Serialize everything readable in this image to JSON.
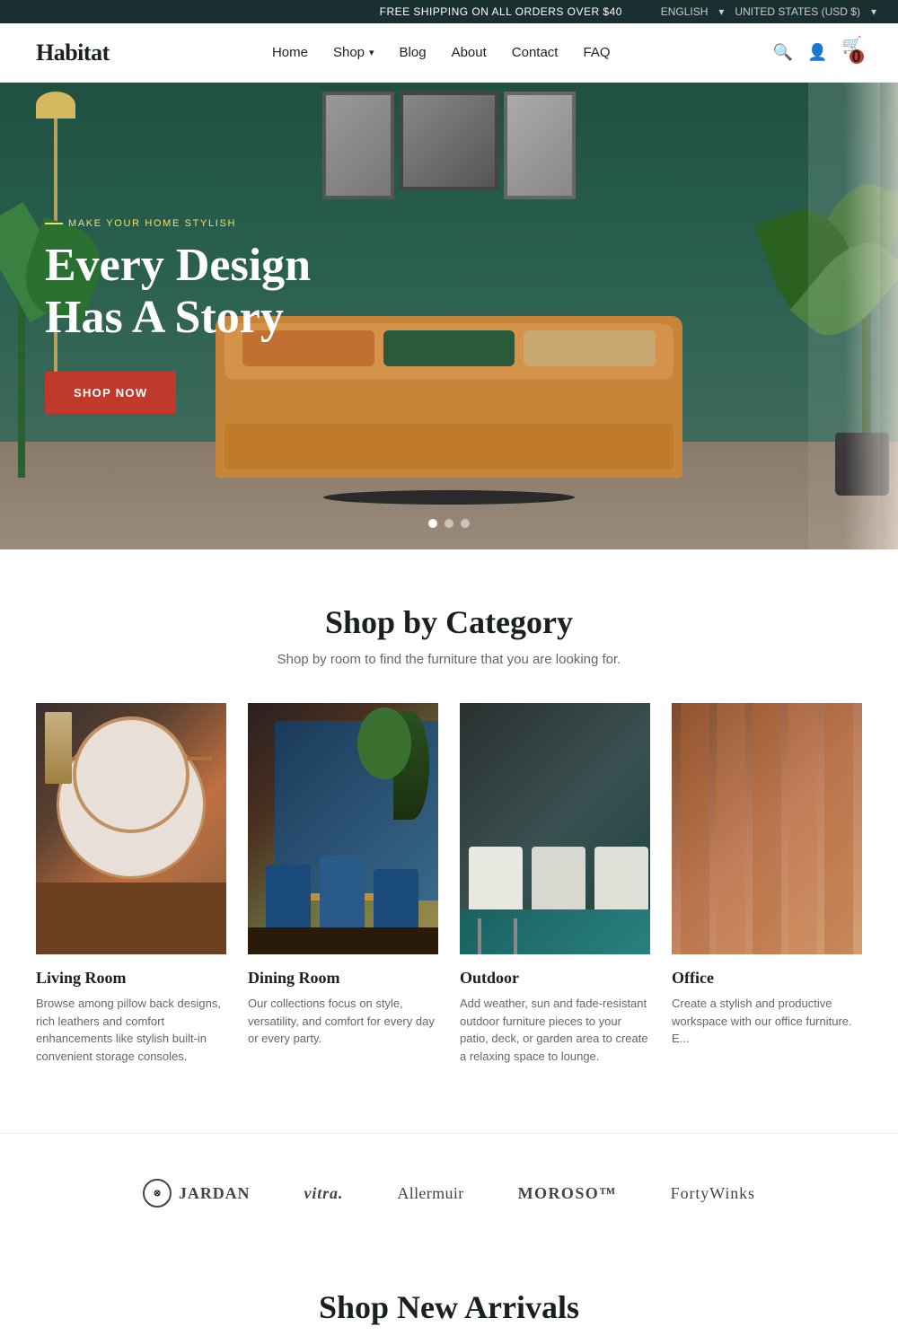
{
  "topbar": {
    "shipping_notice": "FREE SHIPPING ON ALL ORDERS OVER $40",
    "language": "ENGLISH",
    "currency": "UNITED STATES (USD $)"
  },
  "header": {
    "logo": "Habitat",
    "nav": [
      {
        "label": "Home",
        "id": "home"
      },
      {
        "label": "Shop",
        "id": "shop",
        "has_dropdown": true
      },
      {
        "label": "Blog",
        "id": "blog"
      },
      {
        "label": "About",
        "id": "about"
      },
      {
        "label": "Contact",
        "id": "contact"
      },
      {
        "label": "FAQ",
        "id": "faq"
      }
    ],
    "cart_count": "0"
  },
  "hero": {
    "subtitle": "MAKE YOUR HOME STYLISH",
    "title": "Every Design Has A Story",
    "cta_label": "SHOP NOW",
    "dots": [
      1,
      2,
      3
    ],
    "active_dot": 0
  },
  "shop_category": {
    "title": "Shop by Category",
    "subtitle": "Shop by room to find the furniture that you are looking for.",
    "categories": [
      {
        "name": "Living Room",
        "description": "Browse among pillow back designs, rich leathers and comfort enhancements like stylish built-in convenient storage consoles.",
        "id": "living-room"
      },
      {
        "name": "Dining Room",
        "description": "Our collections focus on style, versatility, and comfort for every day or every party.",
        "id": "dining-room"
      },
      {
        "name": "Outdoor",
        "description": "Add weather, sun and fade-resistant outdoor furniture pieces to your patio, deck, or garden area to create a relaxing space to lounge.",
        "id": "outdoor"
      },
      {
        "name": "Office",
        "description": "Create a stylish and productive workspace with our office furniture. E...",
        "id": "office"
      }
    ]
  },
  "brands": [
    {
      "name": "JARDAN",
      "icon": true,
      "id": "jardan"
    },
    {
      "name": "vitra.",
      "id": "vitra"
    },
    {
      "name": "Allermuir",
      "id": "allermuir"
    },
    {
      "name": "MOROSO™",
      "id": "moroso"
    },
    {
      "name": "FortyWinks",
      "id": "fortywinks"
    }
  ],
  "arrivals": {
    "title": "Shop New Arrivals"
  }
}
